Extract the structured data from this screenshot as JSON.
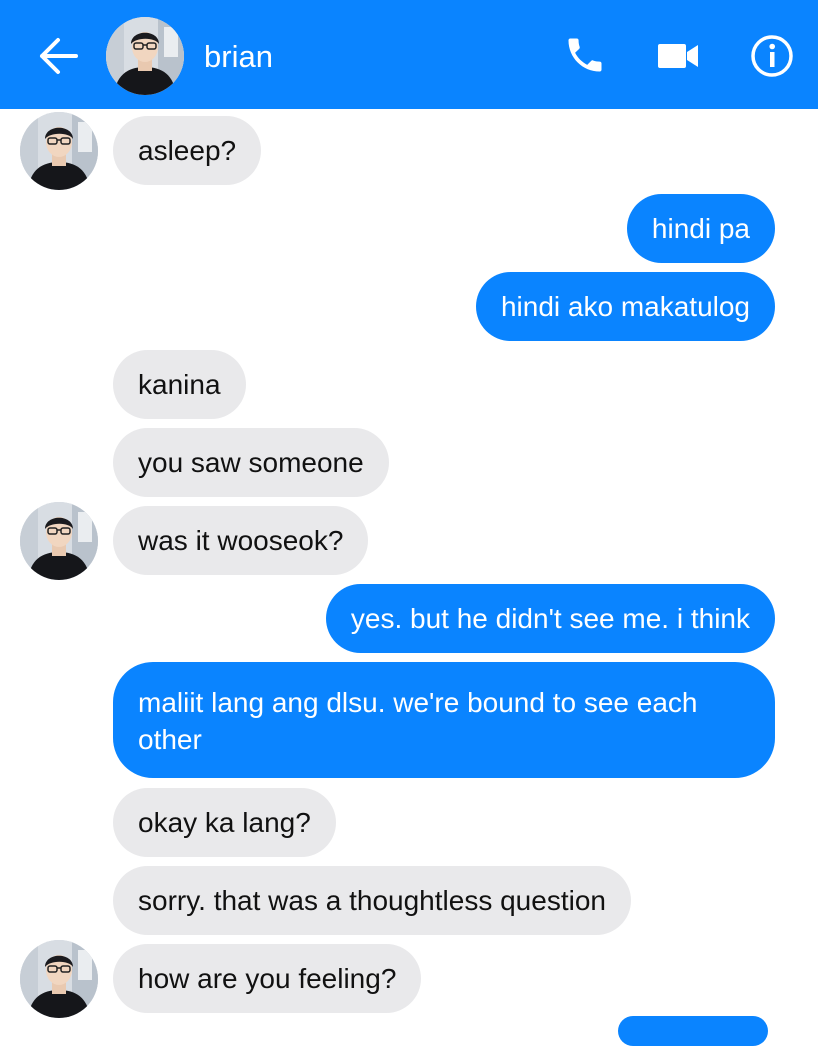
{
  "header": {
    "contact_name": "brian",
    "back_icon": "arrow-left-icon",
    "call_icon": "phone-icon",
    "video_icon": "video-camera-icon",
    "info_icon": "info-icon",
    "background_color": "#0a84ff"
  },
  "messages": [
    {
      "side": "in",
      "text": "asleep?"
    },
    {
      "side": "out",
      "text": "hindi pa"
    },
    {
      "side": "out",
      "text": "hindi ako makatulog"
    },
    {
      "side": "in",
      "text": "kanina"
    },
    {
      "side": "in",
      "text": "you saw someone"
    },
    {
      "side": "in",
      "text": "was it wooseok?"
    },
    {
      "side": "out",
      "text": "yes. but he didn't see me. i think"
    },
    {
      "side": "out",
      "text": "maliit lang ang dlsu. we're bound to see each other"
    },
    {
      "side": "in",
      "text": "okay ka lang?"
    },
    {
      "side": "in",
      "text": "sorry. that was a thoughtless question"
    },
    {
      "side": "in",
      "text": "how are you feeling?"
    }
  ],
  "colors": {
    "outgoing_bubble": "#0a84ff",
    "incoming_bubble": "#e9e9eb"
  }
}
